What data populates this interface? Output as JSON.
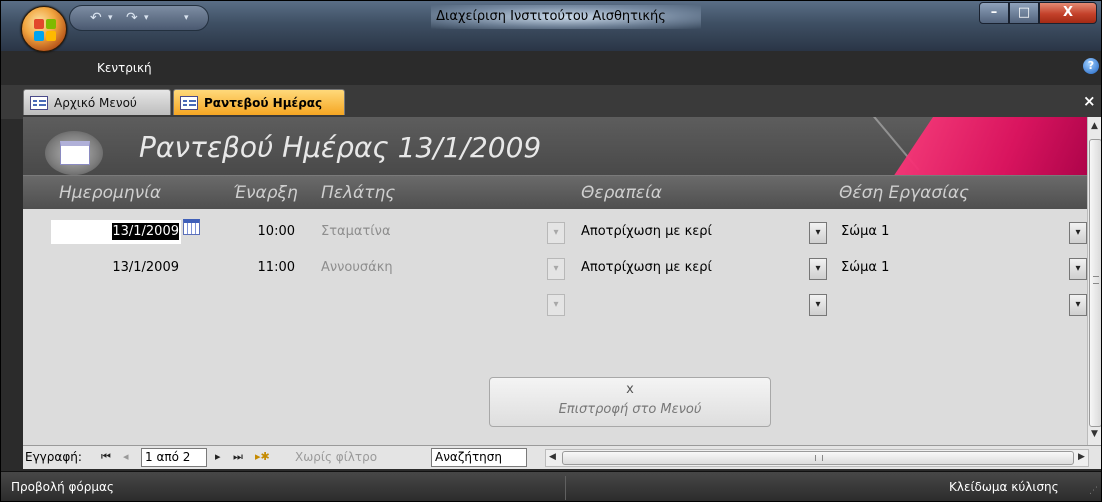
{
  "window": {
    "title": "Διαχείριση Ινστιτούτου Αισθητικής",
    "ribbon_tab": "Κεντρική",
    "help": "?",
    "min_glyph": "–",
    "max_glyph": "□",
    "close_glyph": "X"
  },
  "qat": {
    "undo_glyph": "↶",
    "redo_glyph": "↷",
    "customize_glyph": "▾"
  },
  "doc_tabs": [
    {
      "label": "Αρχικό Μενού",
      "active": false
    },
    {
      "label": "Ραντεβού Ημέρας",
      "active": true
    }
  ],
  "doc_tabs_close": "×",
  "form": {
    "title": "Ραντεβού Ημέρας 13/1/2009",
    "columns": {
      "date": "Ημερομηνία",
      "start": "Έναρξη",
      "client": "Πελάτης",
      "therapy": "Θεραπεία",
      "position": "Θέση Εργασίας"
    },
    "rows": [
      {
        "date": "13/1/2009",
        "time": "10:00",
        "client": "Σταματίνα",
        "therapy": "Αποτρίχωση με κερί",
        "position": "Σώμα 1"
      },
      {
        "date": "13/1/2009",
        "time": "11:00",
        "client": "Αννουσάκη",
        "therapy": "Αποτρίχωση με κερί",
        "position": "Σώμα 1"
      },
      {
        "date": "",
        "time": "",
        "client": "",
        "therapy": "",
        "position": ""
      }
    ],
    "back_button": {
      "x": "x",
      "label": "Επιστροφή στο Μενού"
    }
  },
  "nav": {
    "label": "Εγγραφή:",
    "first": "⏮",
    "prev": "◂",
    "record": "1 από 2",
    "next": "▸",
    "last": "⏭",
    "new": "▸✱",
    "filter": "Χωρίς φίλτρο",
    "search": "Αναζήτηση"
  },
  "status": {
    "left": "Προβολή φόρμας",
    "right": "Κλείδωμα κύλισης"
  },
  "combo_arrow": "▾",
  "colors": {
    "accent_pink": "#e0115f",
    "active_tab": "#f5a623",
    "form_bg": "#dcdcdc"
  }
}
